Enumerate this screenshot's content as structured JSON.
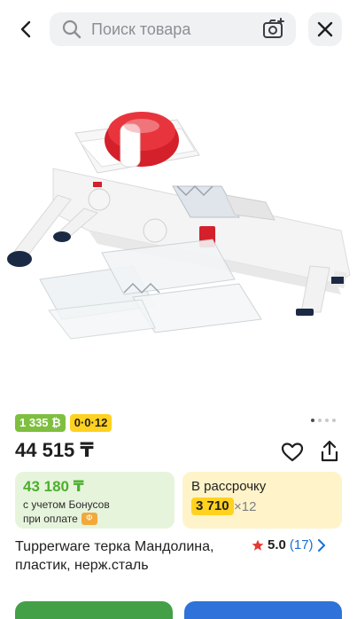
{
  "header": {
    "search_placeholder": "Поиск товара"
  },
  "product": {
    "badges": [
      "1 335 ₿",
      "0·0·12"
    ],
    "price": "44 515 ₸",
    "title": "Tupperware терка Мандолина, пластик, нерж.сталь",
    "rating": {
      "score": "5.0",
      "count": "(17)"
    }
  },
  "bonus_card": {
    "price": "43 180 ₸",
    "line1": "с учетом Бонусов",
    "line2": "при оплате"
  },
  "installment_card": {
    "label": "В рассрочку",
    "amount": "3 710",
    "term": "×12"
  },
  "gallery": {
    "pages": 4,
    "active": 1
  },
  "colors": {
    "accent_green": "#43a047",
    "accent_blue": "#2f73da",
    "badge_yellow": "#ffd21f",
    "badge_green": "#7fbf3f"
  }
}
